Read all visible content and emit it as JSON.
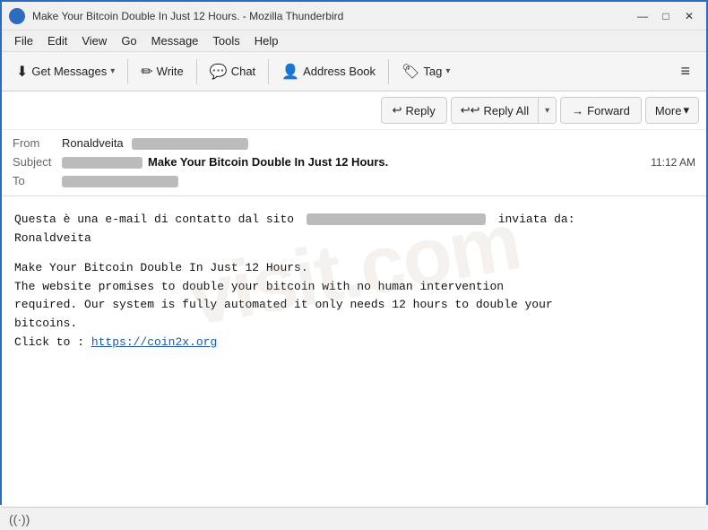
{
  "titleBar": {
    "title": "Make Your Bitcoin Double In Just 12 Hours. - Mozilla Thunderbird",
    "icon": "thunderbird-icon",
    "controls": {
      "minimize": "—",
      "maximize": "□",
      "close": "✕"
    }
  },
  "menuBar": {
    "items": [
      "File",
      "Edit",
      "View",
      "Go",
      "Message",
      "Tools",
      "Help"
    ]
  },
  "toolbar": {
    "getMessages": "Get Messages",
    "write": "Write",
    "chat": "Chat",
    "addressBook": "Address Book",
    "tag": "Tag",
    "hamburger": "≡"
  },
  "emailHeaderToolbar": {
    "reply": "Reply",
    "replyAll": "Reply All",
    "forward": "Forward",
    "more": "More"
  },
  "emailFields": {
    "fromLabel": "From",
    "fromName": "Ronaldveita",
    "subjectLabel": "Subject",
    "subjectText": "Make Your Bitcoin Double In Just 12 Hours.",
    "toLabel": "To",
    "time": "11:12 AM"
  },
  "emailBody": {
    "line1": "Questa è una e-mail di contatto dal sito",
    "line1end": "inviata da:",
    "line2": "Ronaldveita",
    "line3": "",
    "line4": "Make Your Bitcoin Double In Just 12 Hours.",
    "line5": "The website promises to double your bitcoin with no human intervention",
    "line6": "required. Our system is fully automated it only needs 12 hours to double your",
    "line7": "bitcoins.",
    "line8": "Click to :",
    "link": "https://coin2x.org"
  },
  "statusBar": {
    "icon": "signal-icon",
    "iconSymbol": "((·))"
  }
}
